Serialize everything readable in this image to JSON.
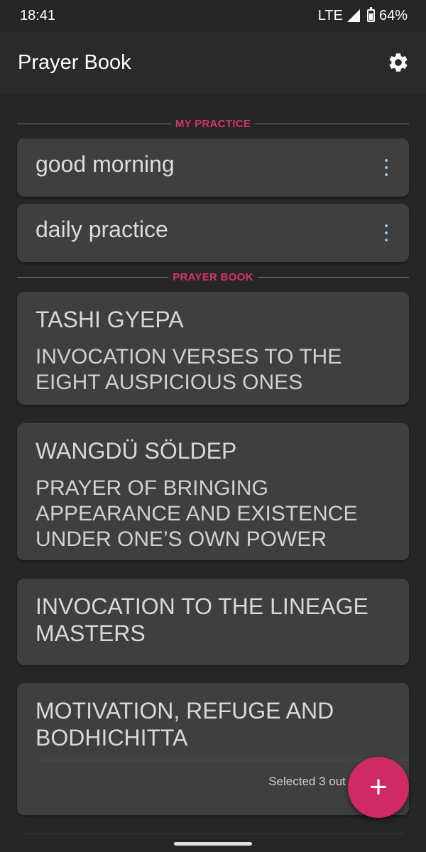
{
  "status_bar": {
    "time": "18:41",
    "network": "LTE",
    "battery": "64%"
  },
  "app_bar": {
    "title": "Prayer Book",
    "settings_icon": "gear-icon"
  },
  "sections": {
    "my_practice_label": "MY PRACTICE",
    "prayer_book_label": "PRAYER BOOK"
  },
  "my_practice": [
    {
      "title": "good morning"
    },
    {
      "title": "daily practice"
    }
  ],
  "prayer_book": [
    {
      "title": "TASHI GYEPA",
      "subtitle": "INVOCATION VERSES TO THE EIGHT AUSPICIOUS ONES"
    },
    {
      "title": "WANGDÜ SÖLDEP",
      "subtitle": "PRAYER OF BRINGING APPEARANCE AND EXISTENCE UNDER ONE’S OWN POWER"
    },
    {
      "title": "INVOCATION TO THE LINEAGE MASTERS"
    },
    {
      "title": "MOTIVATION, REFUGE AND BODHICHITTA",
      "selection_text": "Selected 3 out of 3"
    }
  ],
  "fab": {
    "label": "+"
  },
  "colors": {
    "accent": "#d6336c",
    "fab": "#cf2966",
    "card": "#3f3f3f",
    "background": "#262626"
  }
}
